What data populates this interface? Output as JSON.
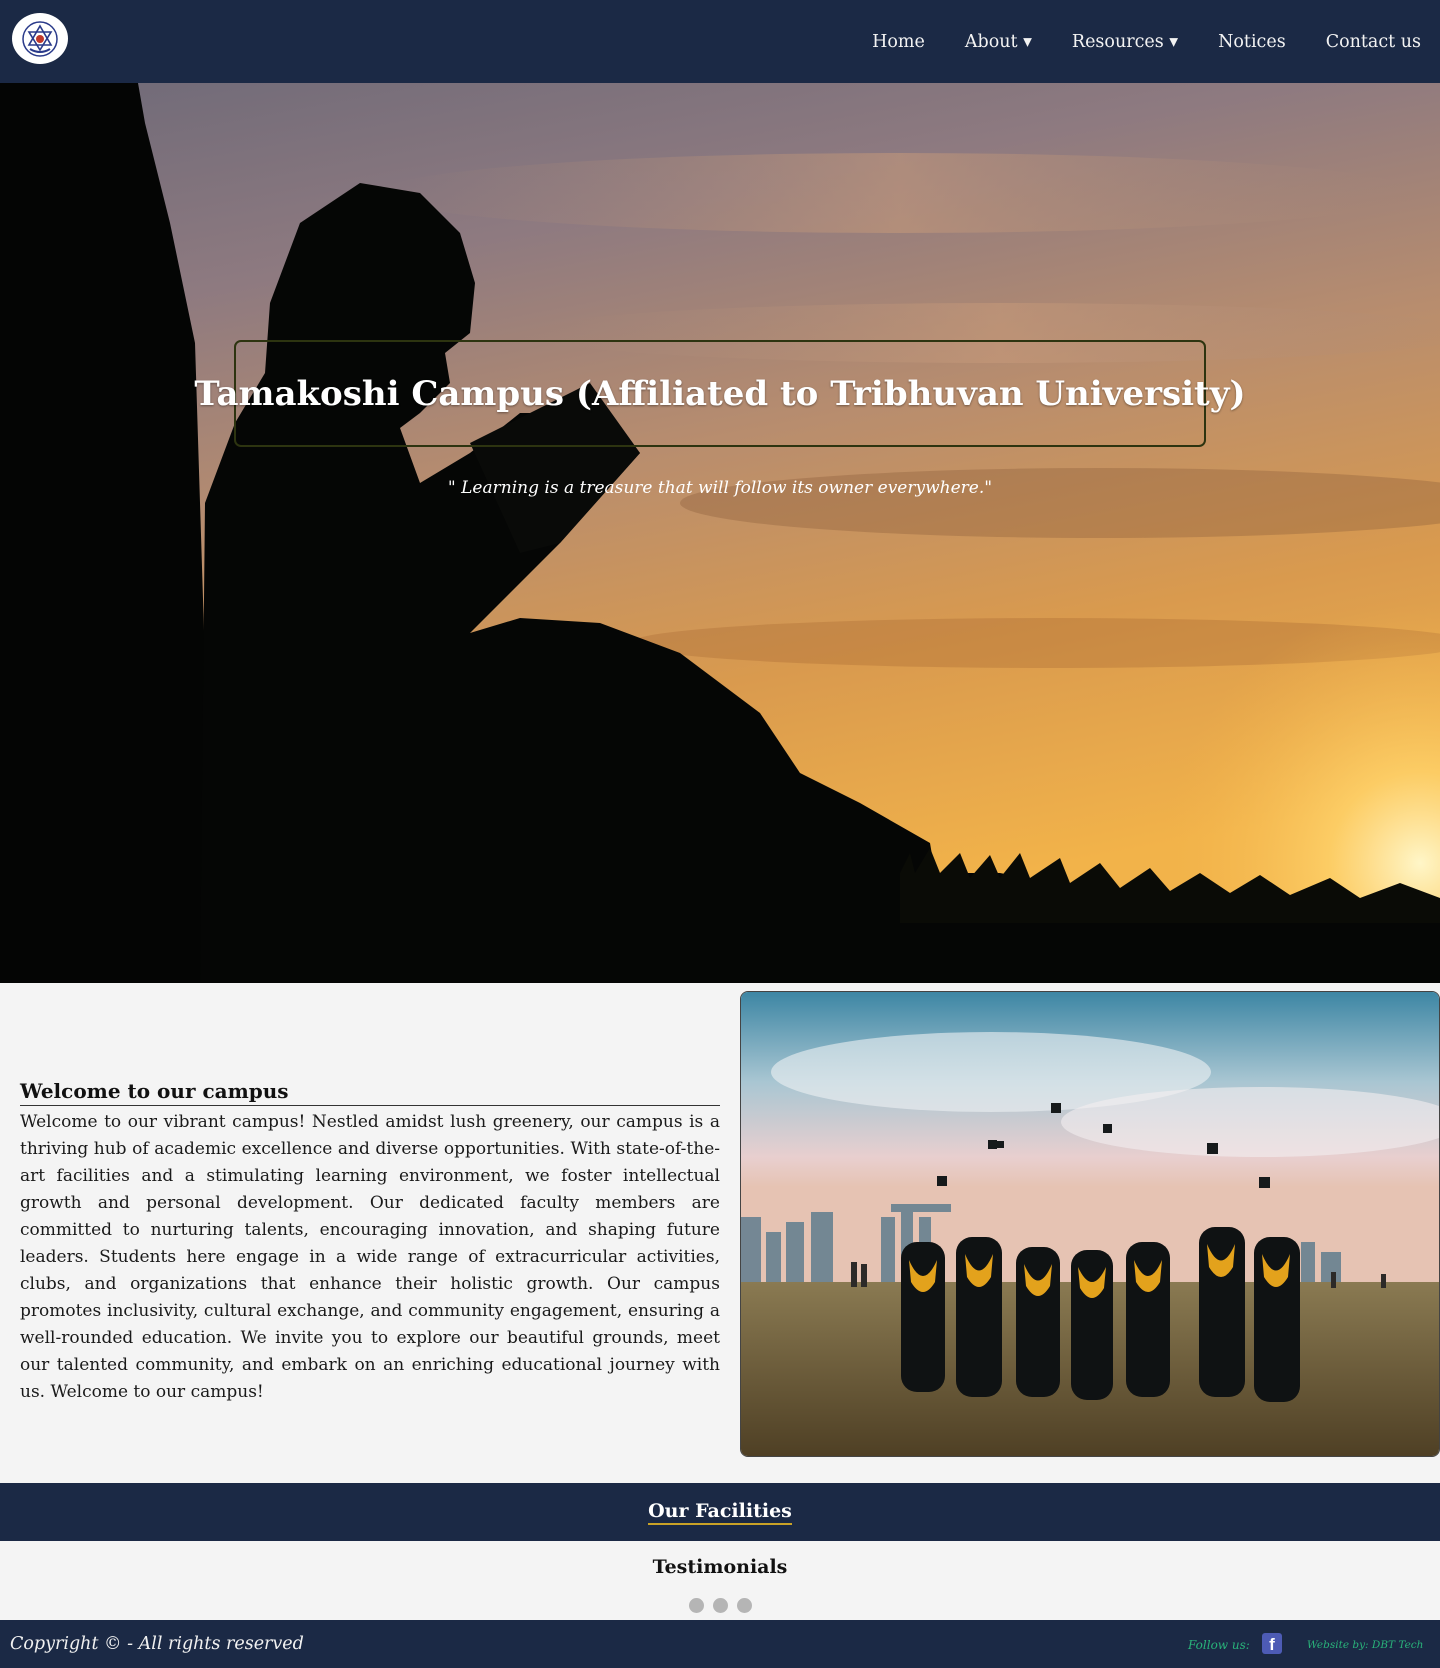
{
  "navbar": {
    "logo_icon": "campus-emblem-icon",
    "links": [
      "Home",
      "About ▾",
      "Resources ▾",
      "Notices",
      "Contact us"
    ]
  },
  "hero": {
    "title": "Tamakoshi Campus (Affiliated to Tribhuvan University)",
    "quote": "\" Learning is a treasure that will follow its owner everywhere.\"",
    "background": "silhouette-reading-at-sunset-image"
  },
  "welcome": {
    "heading": "Welcome to our campus",
    "body": "Welcome to our vibrant campus! Nestled amidst lush greenery, our campus is a thriving hub of academic excellence and diverse opportunities. With state-of-the-art facilities and a stimulating learning environment, we foster intellectual growth and personal development. Our dedicated faculty members are committed to nurturing talents, encouraging innovation, and shaping future leaders. Students here engage in a wide range of extracurricular activities, clubs, and organizations that enhance their holistic growth. Our campus promotes inclusivity, cultural exchange, and community engagement, ensuring a well-rounded education. We invite you to explore our beautiful grounds, meet our talented community, and embark on an enriching educational journey with us. Welcome to our campus!",
    "photo": "graduates-throwing-caps-image"
  },
  "facilities": {
    "title": "Our Facilities"
  },
  "testimonials": {
    "title": "Testimonials",
    "dot_count": 3
  },
  "footer": {
    "copyright": "Copyright © - All rights reserved",
    "follow_label": "Follow us:",
    "facebook_icon": "facebook-icon",
    "credit": "Website by: DBT Tech"
  },
  "colors": {
    "navy": "#1b2945",
    "page_bg": "#f4f4f4",
    "accent_green": "#29b37a",
    "underline_gold": "#c9a227"
  }
}
